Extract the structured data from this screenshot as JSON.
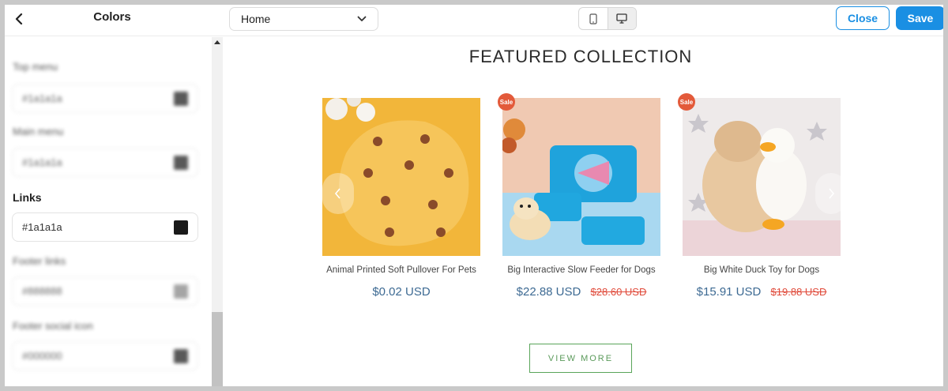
{
  "topbar": {
    "title": "Colors",
    "page_select_value": "Home",
    "close_label": "Close",
    "save_label": "Save"
  },
  "sidebar": {
    "fields": [
      {
        "label": "Top menu",
        "value": "#1a1a1a",
        "swatch": "#222222",
        "blurred": true
      },
      {
        "label": "Main menu",
        "value": "#1a1a1a",
        "swatch": "#222222",
        "blurred": true
      },
      {
        "label": "Links",
        "value": "#1a1a1a",
        "swatch": "#1a1a1a",
        "blurred": false
      },
      {
        "label": "Footer links",
        "value": "#888888",
        "swatch": "#888888",
        "blurred": true
      },
      {
        "label": "Footer social icon",
        "value": "#000000",
        "swatch": "#222222",
        "blurred": true
      }
    ]
  },
  "preview": {
    "section_title": "FEATURED COLLECTION",
    "view_more_label": "VIEW MORE",
    "sale_badge": "Sale",
    "currency_suffix": "USD",
    "products": [
      {
        "name": "Animal Printed Soft Pullover For Pets",
        "price": "$0.02 USD",
        "was": "",
        "sale": false
      },
      {
        "name": "Big Interactive Slow Feeder for Dogs",
        "price": "$22.88 USD",
        "was": "$28.60 USD",
        "sale": true
      },
      {
        "name": "Big White Duck Toy for Dogs",
        "price": "$15.91 USD",
        "was": "$19.88 USD",
        "sale": true
      }
    ]
  },
  "colors": {
    "accent": "#1a8fe3",
    "price": "#3d6a93",
    "strike": "#e04a3a",
    "view_more": "#5aa55a"
  }
}
